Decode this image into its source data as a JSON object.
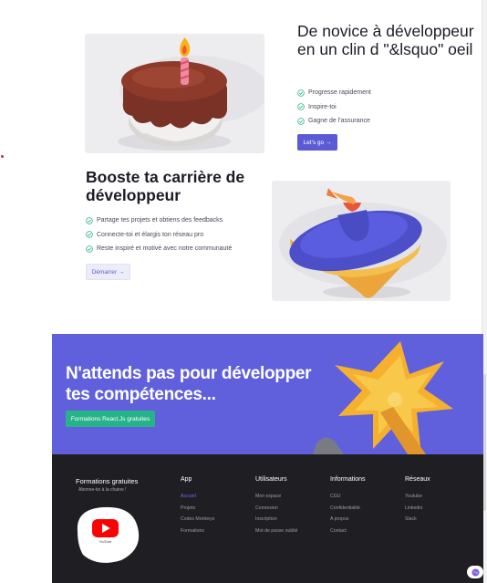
{
  "section_one": {
    "title": "De novice à développeur en un clin d \"&lsquo\" oeil",
    "features": [
      "Progresse rapidement",
      "Inspire-toi",
      "Gagne de l'assurance"
    ],
    "cta_label": "Let's go →"
  },
  "section_two": {
    "title": "Booste ta carrière de développeur",
    "features": [
      "Partage tes projets et obtiens des feedbacks",
      "Connecte-toi et élargis ton réseau pro",
      "Reste inspiré et motivé avec notre communauté"
    ],
    "cta_label": "Démarrer →"
  },
  "banner": {
    "title": "N'attends pas pour développer tes compétences...",
    "cta_label": "Formations React.Js gratuites"
  },
  "footer": {
    "brand_title": "Formations gratuites",
    "brand_subtitle": "Abonne-toi à la chaine !",
    "youtube_caption": "YouTube",
    "columns": [
      {
        "heading": "App",
        "links": [
          "Accueil",
          "Projets",
          "Codes Monkeys",
          "Formations"
        ]
      },
      {
        "heading": "Utilisateurs",
        "links": [
          "Mon espace",
          "Connexion",
          "Inscription",
          "Mot de passe oublié"
        ]
      },
      {
        "heading": "Informations",
        "links": [
          "CGU",
          "Confidentialité",
          "A propos",
          "Contact"
        ]
      },
      {
        "heading": "Réseaux",
        "links": [
          "Youtube",
          "Linkedin",
          "Slack"
        ]
      }
    ]
  },
  "colors": {
    "accent": "#5b5bd6",
    "banner_bg": "#6060dc",
    "success": "#27b38a",
    "footer_bg": "#1f1f23",
    "youtube_red": "#ff0000"
  },
  "icons": {
    "check": "check-circle-icon",
    "cake": "birthday-cake-illustration",
    "top": "spinning-top-illustration",
    "star": "star-burst-illustration",
    "youtube": "youtube-logo-icon",
    "chat": "chat-widget-icon"
  }
}
